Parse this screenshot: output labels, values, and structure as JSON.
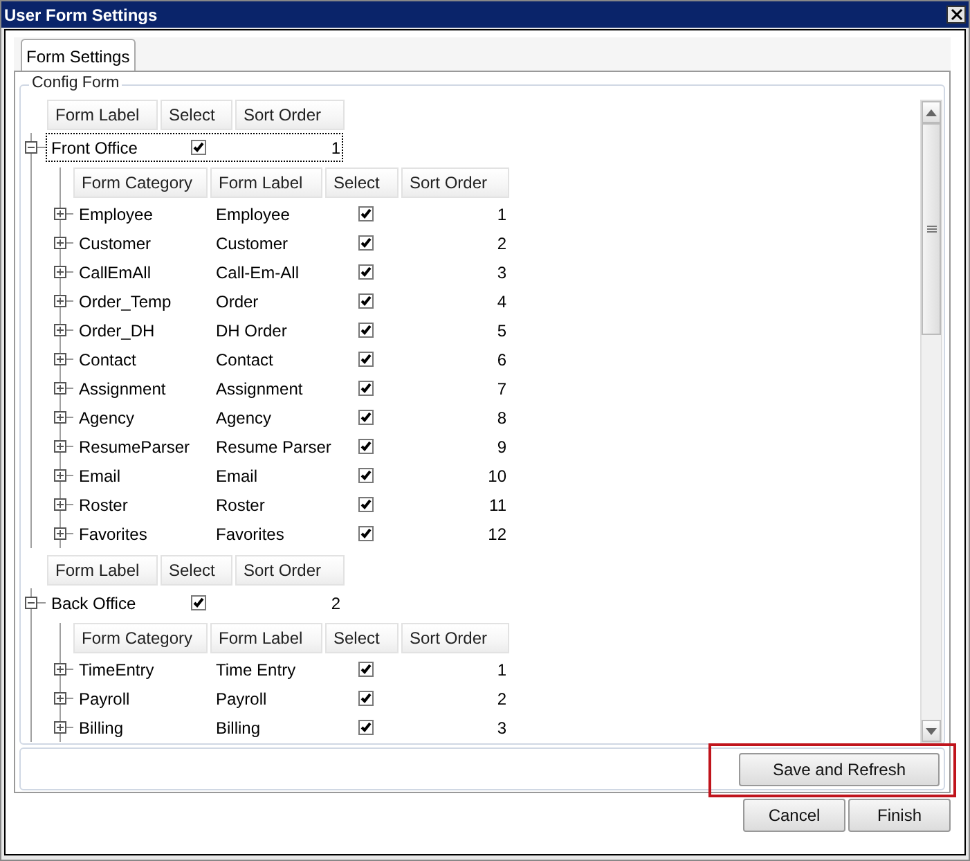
{
  "window": {
    "title": "User Form Settings"
  },
  "tabs": [
    {
      "label": "Form Settings",
      "selected": true
    }
  ],
  "group_box": {
    "title": "Config Form"
  },
  "tree": [
    {
      "columns": [
        "Form Label",
        "Select",
        "Sort Order"
      ],
      "label": "Front Office",
      "checked": true,
      "sort_order": "1",
      "expanded": true,
      "focused": true,
      "sub_columns": [
        "Form Category",
        "Form Label",
        "Select",
        "Sort Order"
      ],
      "children": [
        {
          "category": "Employee",
          "label": "Employee",
          "checked": true,
          "sort_order": "1",
          "expanded": false
        },
        {
          "category": "Customer",
          "label": "Customer",
          "checked": true,
          "sort_order": "2",
          "expanded": false
        },
        {
          "category": "CallEmAll",
          "label": "Call-Em-All",
          "checked": true,
          "sort_order": "3",
          "expanded": false
        },
        {
          "category": "Order_Temp",
          "label": "Order",
          "checked": true,
          "sort_order": "4",
          "expanded": false
        },
        {
          "category": "Order_DH",
          "label": "DH Order",
          "checked": true,
          "sort_order": "5",
          "expanded": false
        },
        {
          "category": "Contact",
          "label": "Contact",
          "checked": true,
          "sort_order": "6",
          "expanded": false
        },
        {
          "category": "Assignment",
          "label": "Assignment",
          "checked": true,
          "sort_order": "7",
          "expanded": false
        },
        {
          "category": "Agency",
          "label": "Agency",
          "checked": true,
          "sort_order": "8",
          "expanded": false
        },
        {
          "category": "ResumeParser",
          "label": "Resume Parser",
          "checked": true,
          "sort_order": "9",
          "expanded": false
        },
        {
          "category": "Email",
          "label": "Email",
          "checked": true,
          "sort_order": "10",
          "expanded": false
        },
        {
          "category": "Roster",
          "label": "Roster",
          "checked": true,
          "sort_order": "11",
          "expanded": false
        },
        {
          "category": "Favorites",
          "label": "Favorites",
          "checked": true,
          "sort_order": "12",
          "expanded": false
        }
      ]
    },
    {
      "columns": [
        "Form Label",
        "Select",
        "Sort Order"
      ],
      "label": "Back Office",
      "checked": true,
      "sort_order": "2",
      "expanded": true,
      "focused": false,
      "sub_columns": [
        "Form Category",
        "Form Label",
        "Select",
        "Sort Order"
      ],
      "children": [
        {
          "category": "TimeEntry",
          "label": "Time Entry",
          "checked": true,
          "sort_order": "1",
          "expanded": false
        },
        {
          "category": "Payroll",
          "label": "Payroll",
          "checked": true,
          "sort_order": "2",
          "expanded": false
        },
        {
          "category": "Billing",
          "label": "Billing",
          "checked": true,
          "sort_order": "3",
          "expanded": false
        }
      ]
    }
  ],
  "panel_buttons": [
    {
      "label": "Save and Refresh",
      "highlighted": true
    }
  ],
  "buttons": [
    {
      "label": "Cancel"
    },
    {
      "label": "Finish"
    }
  ]
}
